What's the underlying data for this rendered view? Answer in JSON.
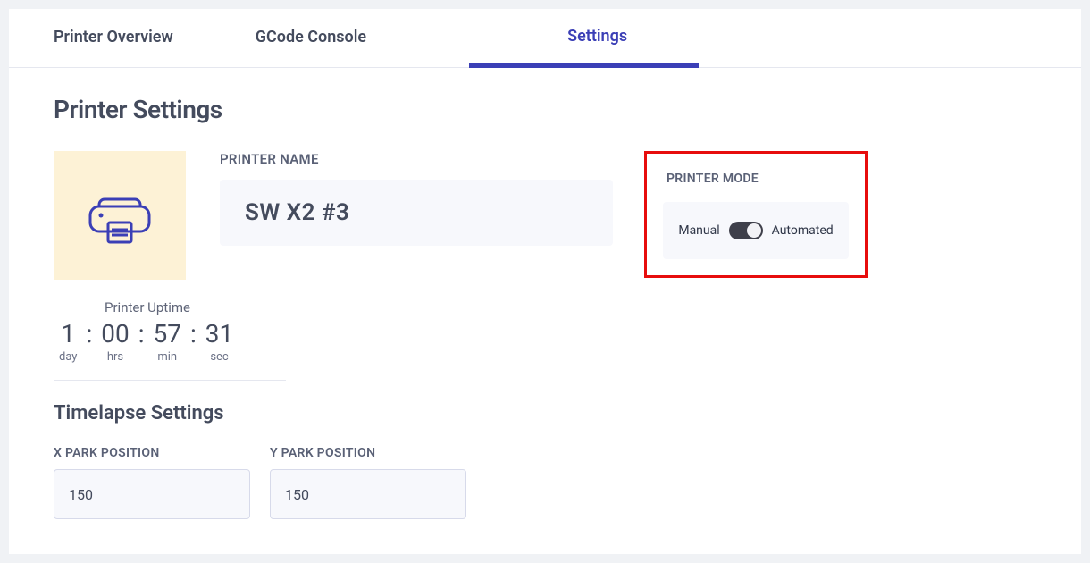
{
  "tabs": {
    "overview": "Printer Overview",
    "gcode": "GCode Console",
    "settings": "Settings"
  },
  "active_tab": "settings",
  "page_title": "Printer Settings",
  "printer_name_label": "PRINTER NAME",
  "printer_name": "SW X2 #3",
  "mode": {
    "label": "PRINTER MODE",
    "left": "Manual",
    "right": "Automated",
    "value": "Automated"
  },
  "uptime": {
    "label": "Printer Uptime",
    "day": "1",
    "hrs": "00",
    "min": "57",
    "sec": "31",
    "units": {
      "day": "day",
      "hrs": "hrs",
      "min": "min",
      "sec": "sec"
    }
  },
  "timelapse": {
    "title": "Timelapse Settings",
    "x_label": "X PARK POSITION",
    "x_value": "150",
    "y_label": "Y PARK POSITION",
    "y_value": "150"
  },
  "highlight": {
    "target": "printer-mode-card",
    "color": "#e70d0d"
  }
}
